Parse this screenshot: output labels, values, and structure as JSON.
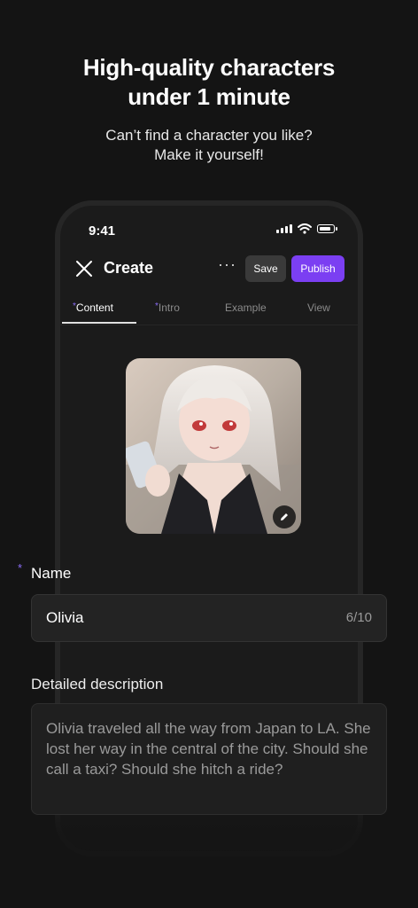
{
  "hero": {
    "title_line1": "High-quality characters",
    "title_line2": "under 1 minute",
    "subtitle_line1": "Can’t find a character you like?",
    "subtitle_line2": "Make it yourself!"
  },
  "status_bar": {
    "time": "9:41"
  },
  "topbar": {
    "title": "Create",
    "more": "···",
    "save_label": "Save",
    "publish_label": "Publish"
  },
  "tabs": [
    {
      "label": "Content",
      "required": "*"
    },
    {
      "label": "Intro",
      "required": "*"
    },
    {
      "label": "Example",
      "required": ""
    },
    {
      "label": "View",
      "required": ""
    }
  ],
  "form": {
    "name_label": "Name",
    "name_required": "*",
    "name_value": "Olivia",
    "name_counter": "6/10",
    "description_label": "Detailed description",
    "description_value": "Olivia traveled all the way from Japan to LA. She lost her way in the central of the city. Should she call a taxi? Should she hitch a ride?"
  },
  "colors": {
    "accent": "#7b3ff2",
    "background": "#141414",
    "required_star": "#8a6cf5"
  },
  "icons": [
    "close-icon",
    "more-icon",
    "signal-icon",
    "wifi-icon",
    "battery-icon",
    "pencil-icon"
  ]
}
